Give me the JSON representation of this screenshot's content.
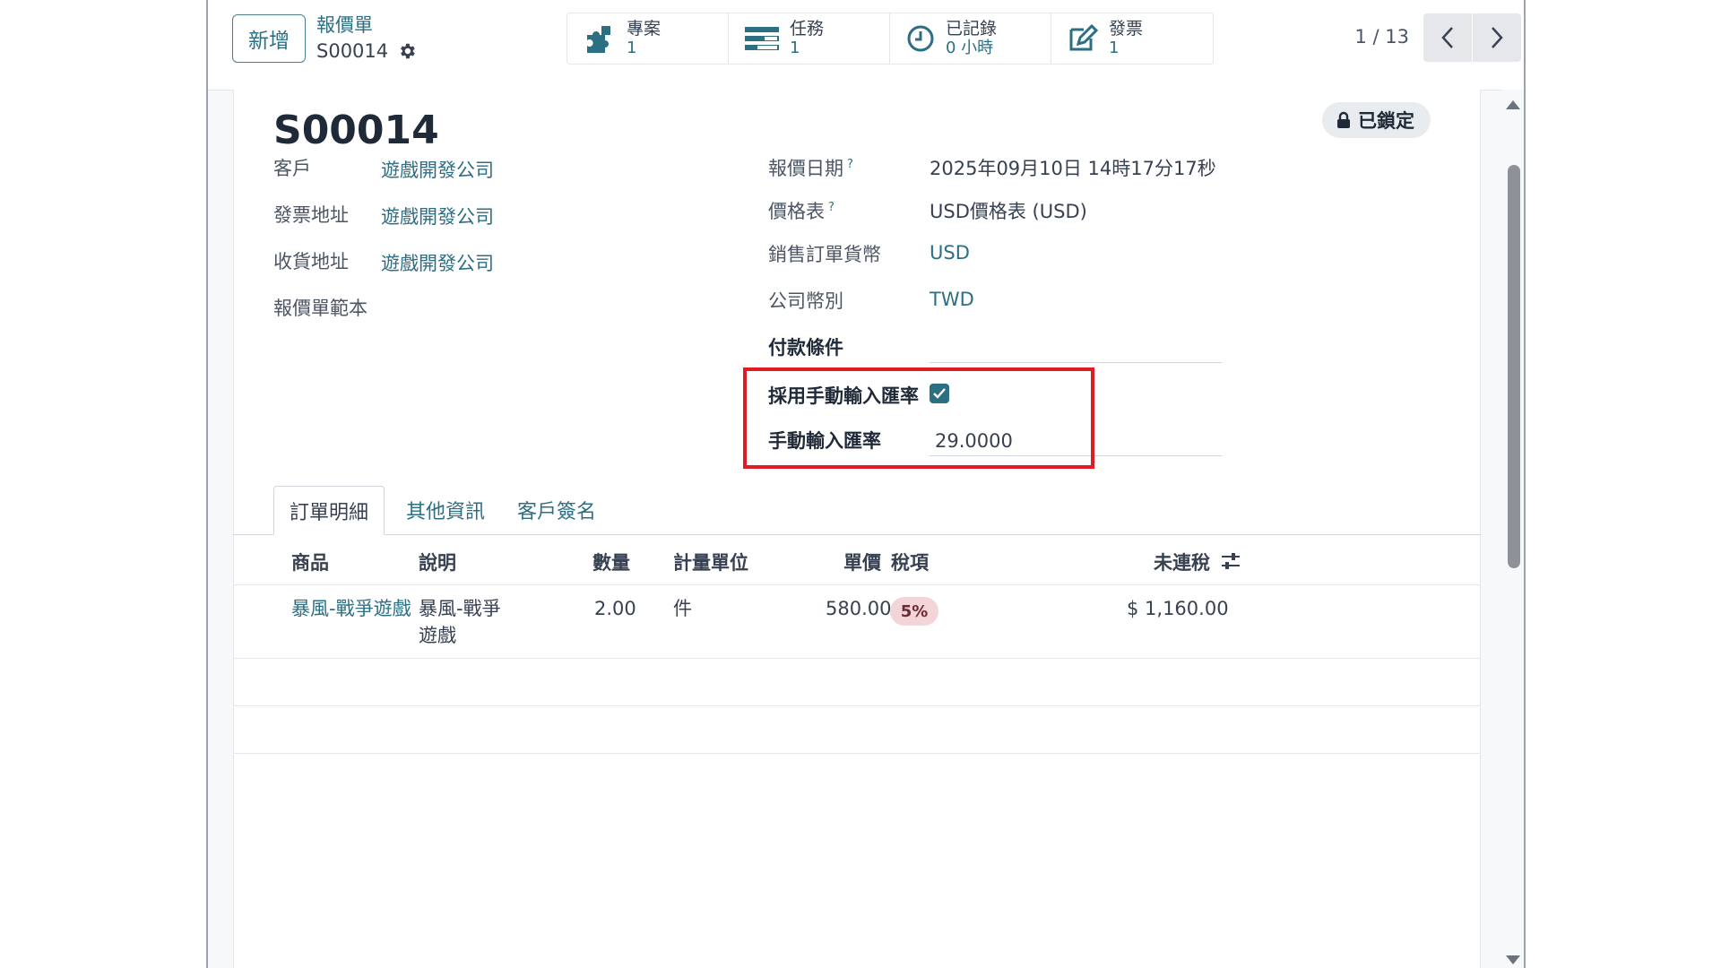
{
  "control_panel": {
    "new_button": "新增",
    "breadcrumb_parent": "報價單",
    "breadcrumb_current": "S00014",
    "smart_buttons": [
      {
        "label": "專案",
        "value": "1",
        "icon": "puzzle-icon"
      },
      {
        "label": "任務",
        "value": "1",
        "icon": "tasks-icon"
      },
      {
        "label": "已記錄",
        "value": "0 小時",
        "icon": "clock-icon"
      },
      {
        "label": "發票",
        "value": "1",
        "icon": "edit-invoice-icon"
      }
    ],
    "pager": "1 / 13"
  },
  "form": {
    "title": "S00014",
    "locked_badge": "已鎖定",
    "left_fields": [
      {
        "label": "客戶",
        "value": "遊戲開發公司"
      },
      {
        "label": "發票地址",
        "value": "遊戲開發公司"
      },
      {
        "label": "收貨地址",
        "value": "遊戲開發公司"
      },
      {
        "label": "報價單範本",
        "value": ""
      }
    ],
    "right_fields": [
      {
        "label": "報價日期",
        "value": "2025年09月10日 14時17分17秒"
      },
      {
        "label": "價格表",
        "value": "USD價格表 (USD)"
      },
      {
        "label": "銷售訂單貨幣",
        "value": "USD"
      },
      {
        "label": "公司幣別",
        "value": "TWD"
      },
      {
        "label": "付款條件",
        "value": ""
      },
      {
        "label": "採用手動輸入匯率",
        "value": ""
      },
      {
        "label": "手動輸入匯率",
        "value": "29.0000"
      }
    ],
    "help_mark": "?"
  },
  "tabs": [
    {
      "label": "訂單明細"
    },
    {
      "label": "其他資訊"
    },
    {
      "label": "客戶簽名"
    }
  ],
  "table": {
    "headers": [
      "商品",
      "說明",
      "數量",
      "計量單位",
      "單價",
      "稅項",
      "未連稅"
    ],
    "rows": [
      {
        "product": "暴風-戰爭遊戲",
        "description_line1": "暴風-戰爭",
        "description_line2": "遊戲",
        "quantity": "2.00",
        "uom": "件",
        "unit_price": "580.00",
        "tax": "5%",
        "subtotal": "$ 1,160.00"
      }
    ]
  },
  "colors": {
    "accent": "#2c6f83",
    "highlight": "#e01b24",
    "tax_badge": "#f3d5d8"
  }
}
